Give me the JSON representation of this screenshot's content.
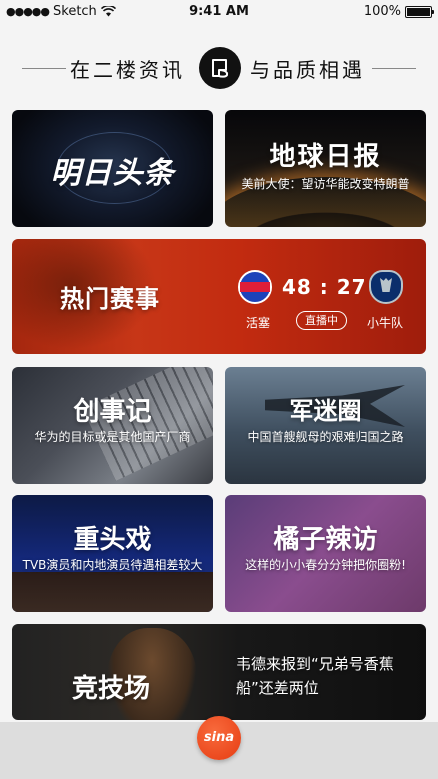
{
  "status_bar": {
    "carrier": "Sketch",
    "time": "9:41 AM",
    "battery": "100%"
  },
  "header": {
    "left_text": "在二楼资讯",
    "right_text": "与品质相遇"
  },
  "cards": {
    "mingri": {
      "title": "明日头条"
    },
    "diqiu": {
      "title": "地球日报",
      "subtitle": "美前大使：望访华能改变特朗普"
    },
    "remen": {
      "title": "热门赛事",
      "home_team": "活塞",
      "away_team": "小牛队",
      "score": "48 : 27",
      "live_label": "直播中"
    },
    "chuangshi": {
      "title": "创事记",
      "subtitle": "华为的目标或是其他国产厂商"
    },
    "junmi": {
      "title": "军迷圈",
      "subtitle": "中国首艘舰母的艰难归国之路"
    },
    "zhongtou": {
      "title": "重头戏",
      "subtitle": "TVB演员和内地演员待遇相差较大"
    },
    "juzi": {
      "title": "橘子辣访",
      "subtitle": "这样的小小春分分钟把你圈粉!"
    },
    "jingji": {
      "title": "竞技场",
      "subtitle": "韦德来报到“兄弟号香蕉船”还差两位"
    }
  },
  "tabbar": {
    "brand": "sina"
  },
  "icons": {
    "signal": "signal-dots-icon",
    "wifi": "wifi-icon",
    "battery": "battery-icon",
    "logo": "paper-logo-icon",
    "brand": "sina-icon"
  },
  "colors": {
    "accent": "#e63c12",
    "background": "#f4f4f4",
    "event_red": "#c22b10"
  }
}
